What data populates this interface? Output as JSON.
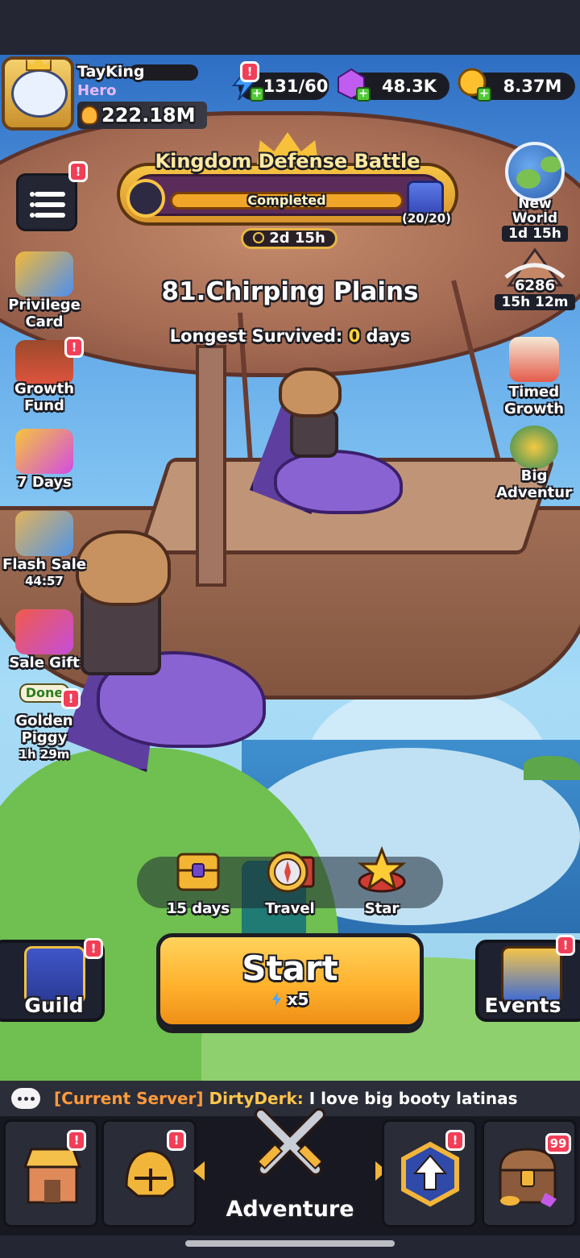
{
  "player": {
    "name": "TayKing",
    "title": "Hero",
    "power": "222.18M"
  },
  "resources": {
    "energy": "131/60",
    "gems": "48.3K",
    "coins": "8.37M"
  },
  "event_banner": {
    "title": "Kingdom Defense Battle",
    "status": "Completed",
    "count": "(20/20)",
    "timer": "2d 15h",
    "progress": 1.0
  },
  "new_world": {
    "label": "New\nWorld",
    "timer": "1d 15h"
  },
  "ranking": {
    "value": "6286",
    "timer": "15h 12m"
  },
  "stage": {
    "title": "81.Chirping Plains",
    "survived_prefix": "Longest Survived:",
    "survived_days": "0",
    "survived_suffix": "days"
  },
  "left_menu": [
    {
      "label": "Privilege\nCard"
    },
    {
      "label": "Growth\nFund"
    },
    {
      "label": "7 Days"
    },
    {
      "label": "Flash Sale",
      "timer": "44:57"
    },
    {
      "label": "Sale Gift"
    },
    {
      "label": "Golden\nPiggy",
      "status": "Done",
      "timer": "1h 29m"
    }
  ],
  "right_menu": [
    {
      "label": "Timed\nGrowth"
    },
    {
      "label": "Big\nAdventur"
    }
  ],
  "tray": [
    {
      "label": "15 days"
    },
    {
      "label": "Travel"
    },
    {
      "label": "Star"
    }
  ],
  "start": {
    "label": "Start",
    "cost": "x5"
  },
  "guild": {
    "label": "Guild"
  },
  "events": {
    "label": "Events"
  },
  "chat": {
    "server": "[Current Server]",
    "user": "DirtyDerk:",
    "message": "I love big booty latinas"
  },
  "nav": {
    "center_label": "Adventure",
    "chest_badge": "99"
  },
  "badges": {
    "alert": "!"
  },
  "colors": {
    "accent_orange": "#ffb22e",
    "badge_red": "#f23e57",
    "chat_server": "#ff9a3d",
    "highlight_yellow": "#ffd33b"
  }
}
